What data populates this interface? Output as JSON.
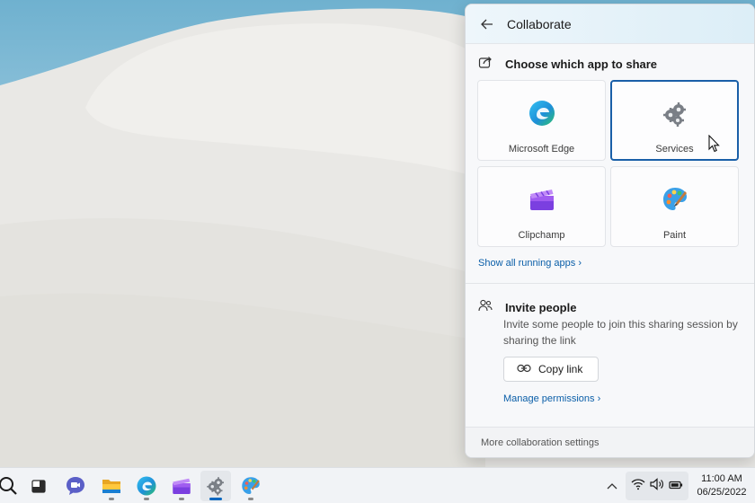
{
  "flyout": {
    "title": "Collaborate",
    "share_app_heading": "Choose which app to share",
    "apps": [
      {
        "name": "Microsoft Edge",
        "icon": "edge-icon",
        "selected": false
      },
      {
        "name": "Services",
        "icon": "services-gears-icon",
        "selected": true
      },
      {
        "name": "Clipchamp",
        "icon": "clipchamp-icon",
        "selected": false
      },
      {
        "name": "Paint",
        "icon": "paint-palette-icon",
        "selected": false
      }
    ],
    "show_all_link": "Show all running apps",
    "invite_heading": "Invite people",
    "invite_description": "Invite some people to join this sharing session by sharing the link",
    "copy_link_label": "Copy link",
    "manage_permissions_link": "Manage permissions",
    "footer_link": "More collaboration settings"
  },
  "taskbar": {
    "apps": [
      {
        "icon": "search-icon"
      },
      {
        "icon": "task-view-icon"
      },
      {
        "icon": "teams-chat-icon"
      },
      {
        "icon": "file-explorer-icon"
      },
      {
        "icon": "edge-icon"
      },
      {
        "icon": "clipchamp-icon"
      },
      {
        "icon": "services-gears-icon",
        "active": true
      },
      {
        "icon": "paint-palette-icon"
      }
    ],
    "tray_icons": [
      "chevron-up-icon",
      "wifi-icon",
      "volume-icon",
      "battery-icon"
    ],
    "time": "11:00 AM",
    "date": "06/25/2022"
  },
  "colors": {
    "accent": "#0067c0",
    "selected_border": "#1a5fa8",
    "link": "#0a5ea8"
  }
}
